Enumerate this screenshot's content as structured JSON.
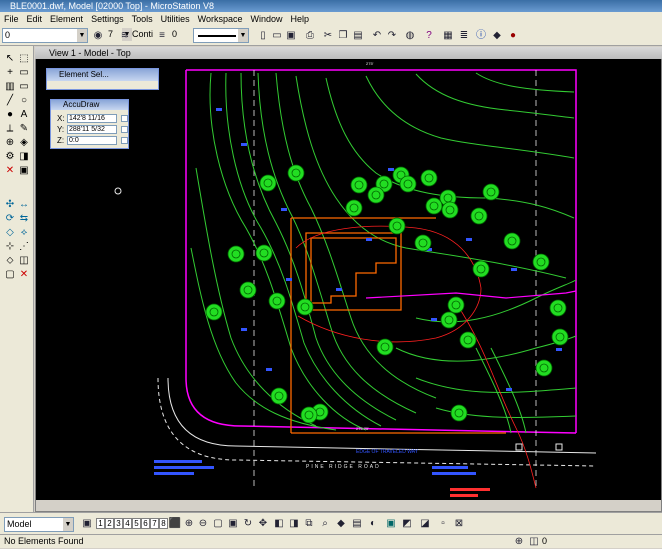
{
  "window": {
    "title": "BLE0001.dwf, Model [02000 Top] - MicroStation V8"
  },
  "menu": [
    "File",
    "Edit",
    "Element",
    "Settings",
    "Tools",
    "Utilities",
    "Workspace",
    "Window",
    "Help"
  ],
  "toolbar": {
    "level_value": "0",
    "color_value": "7",
    "style_value": "Conti",
    "weight_value": "0"
  },
  "view": {
    "title": "View 1 - Model - Top"
  },
  "element_selection": {
    "title": "Element Sel..."
  },
  "accudraw": {
    "title": "AccuDraw",
    "x_label": "X:",
    "x_value": "142'8  11/16",
    "y_label": "Y:",
    "y_value": "288'11  5/32",
    "z_label": "Z:",
    "z_value": "0:0"
  },
  "drawing": {
    "street_label": "EDGE OF TRAVELED WAY",
    "road_label": "PINE RIDGE ROAD",
    "dim_top": "275'",
    "dim_bottom": "275.75'"
  },
  "bottom": {
    "model_value": "Model",
    "view_buttons": [
      "1",
      "2",
      "3",
      "4",
      "5",
      "6",
      "7",
      "8"
    ],
    "level_value": "0"
  },
  "status": {
    "message": "No Elements Found"
  }
}
